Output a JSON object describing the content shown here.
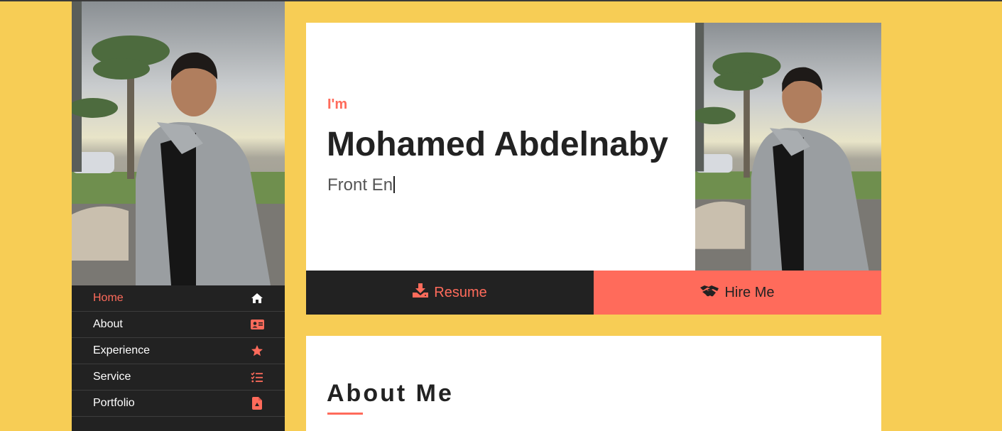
{
  "theme": {
    "background": "#f7cd55",
    "accent": "#ff6b5b",
    "dark": "#222222"
  },
  "sidebar": {
    "nav": [
      {
        "label": "Home",
        "icon": "home-icon",
        "active": true
      },
      {
        "label": "About",
        "icon": "id-card-icon",
        "active": false
      },
      {
        "label": "Experience",
        "icon": "star-icon",
        "active": false
      },
      {
        "label": "Service",
        "icon": "list-check-icon",
        "active": false
      },
      {
        "label": "Portfolio",
        "icon": "file-icon",
        "active": false
      }
    ]
  },
  "hero": {
    "pre": "I'm",
    "name": "Mohamed Abdelnaby",
    "role_typed": "Front En"
  },
  "buttons": {
    "resume": "Resume",
    "hire": "Hire Me"
  },
  "about": {
    "title": "About Me"
  }
}
